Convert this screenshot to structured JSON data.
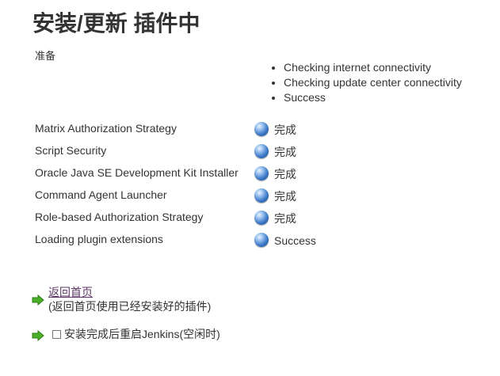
{
  "page": {
    "title": "安装/更新 插件中"
  },
  "preparation": {
    "label": "准备",
    "checks": [
      "Checking internet connectivity",
      "Checking update center connectivity",
      "Success"
    ]
  },
  "plugins": [
    {
      "name": "Matrix Authorization Strategy",
      "status": "完成",
      "status_icon": "blue-ball-icon"
    },
    {
      "name": "Script Security",
      "status": "完成",
      "status_icon": "blue-ball-icon"
    },
    {
      "name": "Oracle Java SE Development Kit Installer",
      "status": "完成",
      "status_icon": "blue-ball-icon"
    },
    {
      "name": "Command Agent Launcher",
      "status": "完成",
      "status_icon": "blue-ball-icon"
    },
    {
      "name": "Role-based Authorization Strategy",
      "status": "完成",
      "status_icon": "blue-ball-icon"
    },
    {
      "name": "Loading plugin extensions",
      "status": "Success",
      "status_icon": "blue-ball-icon"
    }
  ],
  "actions": {
    "home_link": "返回首页",
    "home_note": "(返回首页使用已经安装好的插件)",
    "restart_label": "安装完成后重启Jenkins(空闲时)",
    "restart_checked": false
  },
  "colors": {
    "arrow": "#4caf2a",
    "link": "#5c3566",
    "status_ball": "#3a78c7"
  }
}
